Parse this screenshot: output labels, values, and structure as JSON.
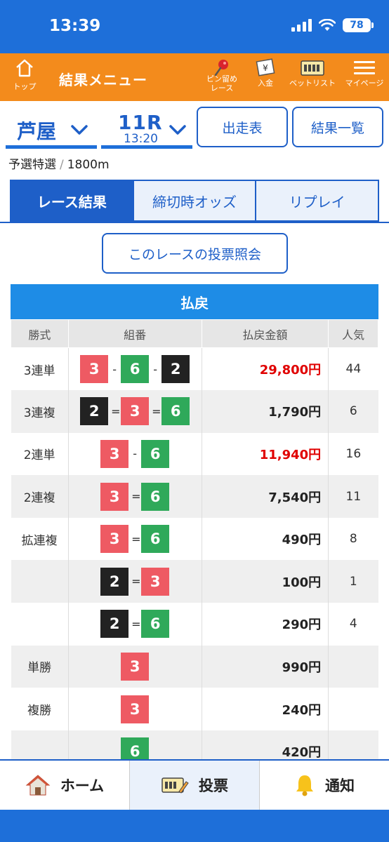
{
  "status": {
    "time": "13:39",
    "battery": "78"
  },
  "header": {
    "home_label": "トップ",
    "title": "結果メニュー",
    "nav": [
      {
        "label": "ピン留め\nレース",
        "icon": "pin-icon"
      },
      {
        "label": "入金",
        "icon": "yen-ticket-icon"
      },
      {
        "label": "ベットリスト",
        "icon": "ticket-list-icon"
      },
      {
        "label": "マイページ",
        "icon": "menu-icon"
      }
    ]
  },
  "selectors": {
    "venue": "芦屋",
    "race": "11R",
    "race_time": "13:20"
  },
  "buttons": {
    "entry_table": "出走表",
    "results_list": "結果一覧",
    "vote_inquiry": "このレースの投票照会"
  },
  "race_info": {
    "grade": "予選特選",
    "distance": "1800m"
  },
  "tabs": [
    {
      "label": "レース結果",
      "active": true
    },
    {
      "label": "締切時オッズ",
      "active": false
    },
    {
      "label": "リプレイ",
      "active": false
    }
  ],
  "payout": {
    "title": "払戻",
    "headers": {
      "type": "勝式",
      "combo": "組番",
      "amount": "払戻金額",
      "popularity": "人気"
    },
    "rows": [
      {
        "type": "3連単",
        "combo": [
          "3",
          "6",
          "2"
        ],
        "seps": [
          "-",
          "-"
        ],
        "amount": "29,800円",
        "popularity": "44",
        "highlight": true
      },
      {
        "type": "3連複",
        "combo": [
          "2",
          "3",
          "6"
        ],
        "seps": [
          "=",
          "="
        ],
        "amount": "1,790円",
        "popularity": "6",
        "highlight": false
      },
      {
        "type": "2連単",
        "combo": [
          "3",
          "6"
        ],
        "seps": [
          "-"
        ],
        "amount": "11,940円",
        "popularity": "16",
        "highlight": true
      },
      {
        "type": "2連複",
        "combo": [
          "3",
          "6"
        ],
        "seps": [
          "="
        ],
        "amount": "7,540円",
        "popularity": "11",
        "highlight": false
      },
      {
        "type": "拡連複",
        "combo": [
          "3",
          "6"
        ],
        "seps": [
          "="
        ],
        "amount": "490円",
        "popularity": "8",
        "highlight": false
      },
      {
        "type": "",
        "combo": [
          "2",
          "3"
        ],
        "seps": [
          "="
        ],
        "amount": "100円",
        "popularity": "1",
        "highlight": false
      },
      {
        "type": "",
        "combo": [
          "2",
          "6"
        ],
        "seps": [
          "="
        ],
        "amount": "290円",
        "popularity": "4",
        "highlight": false
      },
      {
        "type": "単勝",
        "combo": [
          "3"
        ],
        "seps": [],
        "amount": "990円",
        "popularity": "",
        "highlight": false
      },
      {
        "type": "複勝",
        "combo": [
          "3"
        ],
        "seps": [],
        "amount": "240円",
        "popularity": "",
        "highlight": false
      },
      {
        "type": "",
        "combo": [
          "6"
        ],
        "seps": [],
        "amount": "420円",
        "popularity": "",
        "highlight": false
      }
    ]
  },
  "bottom_nav": [
    {
      "label": "ホーム",
      "icon": "house-icon",
      "active": false
    },
    {
      "label": "投票",
      "icon": "ticket-pencil-icon",
      "active": true
    },
    {
      "label": "通知",
      "icon": "bell-icon",
      "active": false
    }
  ],
  "colors": {
    "header_orange": "#f38b1c",
    "primary_blue": "#1e5fc8",
    "payout_blue": "#1e8ce6",
    "highlight_red": "#e00000",
    "boat_3": "#ee5a63",
    "boat_6": "#2fa95a",
    "boat_2": "#222222"
  }
}
